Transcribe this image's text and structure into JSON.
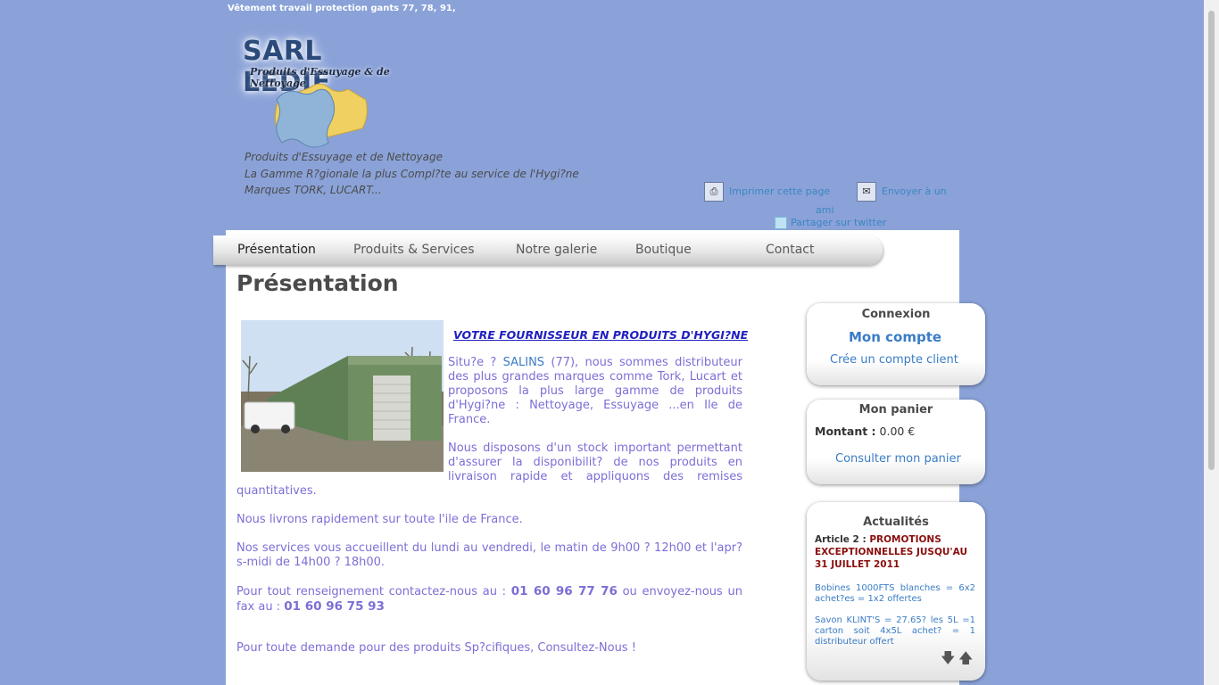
{
  "header": {
    "topline": "Vêtement travail protection gants 77, 78, 91,",
    "logo_title": "SARL LEDIF",
    "logo_subtitle": "Produits d'Essuyage & de Nettoyage",
    "slogan_1": "Produits d'Essuyage et de Nettoyage",
    "slogan_2": "La Gamme R?gionale la plus Compl?te au service de l'Hygi?ne",
    "slogan_3": "Marques TORK, LUCART..."
  },
  "tools": {
    "print": "Imprimer cette page",
    "send_a": "Envoyer à un",
    "send_b": "ami",
    "twitter": "Partager sur twitter"
  },
  "nav": [
    "Présentation",
    "Produits & Services",
    "Notre galerie",
    "Boutique",
    "Contact"
  ],
  "main": {
    "title": "Présentation",
    "headline": "VOTRE FOURNISSEUR EN PRODUITS D'HYGI?NE",
    "p1_pre": "Situ?e ? ",
    "p1_link": "SALINS",
    "p1_post": " (77), nous sommes distributeur des plus grandes marques comme Tork, Lucart et proposons la plus large gamme de produits d'Hygi?ne : Nettoyage, Essuyage ...en Ile de France.",
    "p2_a": "Nous disposons d'un stock important permettant d'assurer la disponibilit? de nos produits en livraison rapide et appliquons des remises",
    "p2_b": "quantitatives.",
    "p3": "Nous livrons rapidement sur toute l'ile de France.",
    "p4": "Nos services vous accueillent du lundi au vendredi, le matin de 9h00 ? 12h00 et l'apr?s-midi de 14h00 ? 18h00.",
    "p5_pre": "Pour tout renseignement contactez-nous au : ",
    "phone": "01 60 96 77 76",
    "p5_mid": " ou envoyez-nous un fax au : ",
    "fax": "01 60 96 75 93",
    "p6": "Pour toute demande pour des produits Sp?cifiques, Consultez-Nous !"
  },
  "sidebar": {
    "login": {
      "title": "Connexion",
      "account": "Mon compte",
      "create": "Crée un compte client"
    },
    "cart": {
      "title": "Mon panier",
      "amount_label": "Montant :",
      "amount_value": "0.00 €",
      "view": "Consulter mon panier"
    },
    "news": {
      "title": "Actualités",
      "article_label": "Article 2 :",
      "article_title": "PROMOTIONS EXCEPTIONNELLES JUSQU'AU 31 JUILLET 2011",
      "item1": "Bobines 1000FTS blanches = 6x2 achet?es = 1x2 offertes",
      "item2": "Savon KLINT'S = 27.65? les 5L =1 carton soit 4x5L achet? = 1 distributeur offert"
    }
  },
  "colors": {
    "background": "#8aa2d8",
    "link": "#3a7cc6",
    "body_text": "#7b6fd6",
    "promo": "#8a0f0f"
  }
}
